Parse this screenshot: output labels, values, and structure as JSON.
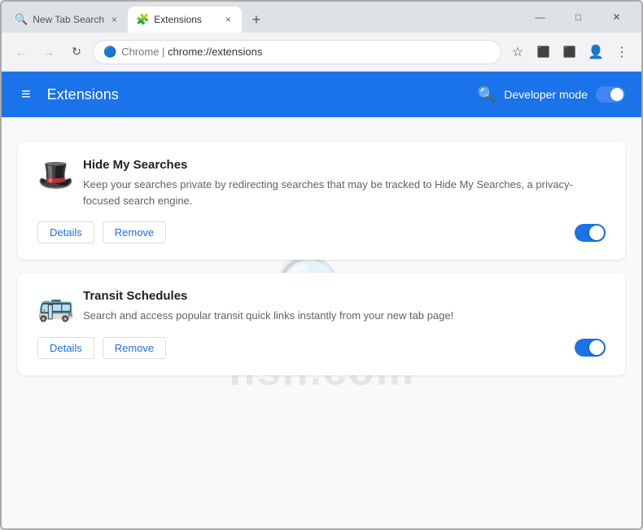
{
  "browser": {
    "title_bar": {
      "tabs": [
        {
          "id": "tab-new-tab-search",
          "title": "New Tab Search",
          "icon": "🔍",
          "active": false,
          "close": "×"
        },
        {
          "id": "tab-extensions",
          "title": "Extensions",
          "icon": "🧩",
          "active": true,
          "close": "×"
        }
      ],
      "new_tab_label": "+",
      "window_controls": {
        "minimize": "—",
        "maximize": "□",
        "close": "✕"
      }
    },
    "address_bar": {
      "back_icon": "←",
      "forward_icon": "→",
      "reload_icon": "↻",
      "url_icon": "🔵",
      "url_prefix": "Chrome  |  ",
      "url": "chrome://extensions",
      "bookmark_icon": "☆",
      "ext_icon1": "⬛",
      "ext_icon2": "⬛",
      "avatar_icon": "👤",
      "menu_icon": "⋮"
    }
  },
  "extensions_page": {
    "header": {
      "hamburger": "≡",
      "title": "Extensions",
      "search_icon": "🔍",
      "developer_mode_label": "Developer mode"
    },
    "extensions": [
      {
        "id": "hide-my-searches",
        "name": "Hide My Searches",
        "description": "Keep your searches private by redirecting searches that may be tracked to Hide My Searches, a privacy-focused search engine.",
        "icon": "🎩",
        "enabled": true,
        "details_label": "Details",
        "remove_label": "Remove"
      },
      {
        "id": "transit-schedules",
        "name": "Transit Schedules",
        "description": "Search and access popular transit quick links instantly from your new tab page!",
        "icon": "🚌",
        "enabled": true,
        "details_label": "Details",
        "remove_label": "Remove"
      }
    ]
  }
}
